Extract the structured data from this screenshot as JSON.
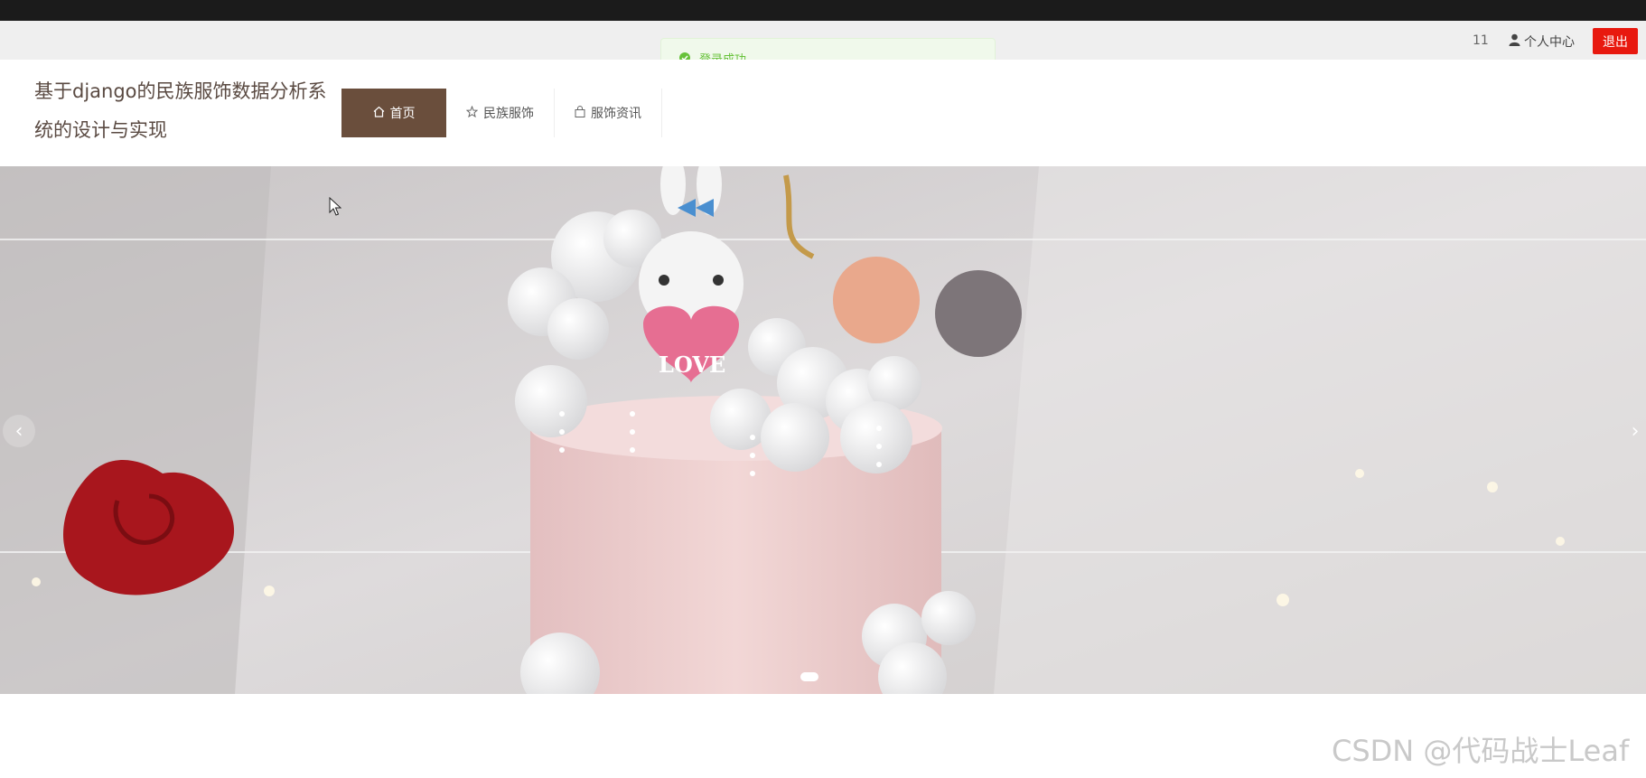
{
  "userbar": {
    "username": "11",
    "center_label": "个人中心",
    "logout_label": "退出"
  },
  "toast": {
    "message": "登录成功"
  },
  "header": {
    "title": "基于django的民族服饰数据分析系统的设计与实现",
    "nav": [
      {
        "label": "首页",
        "icon": "home-icon",
        "active": true
      },
      {
        "label": "民族服饰",
        "icon": "star-icon",
        "active": false
      },
      {
        "label": "服饰资讯",
        "icon": "bag-icon",
        "active": false
      }
    ]
  },
  "carousel": {
    "image_content": "LOVE",
    "prev_label": "‹",
    "next_label": "›"
  },
  "watermark": "CSDN @代码战士Leaf",
  "colors": {
    "accent": "#6a4e3c",
    "logout": "#e8190f",
    "toast_text": "#67c23a"
  }
}
